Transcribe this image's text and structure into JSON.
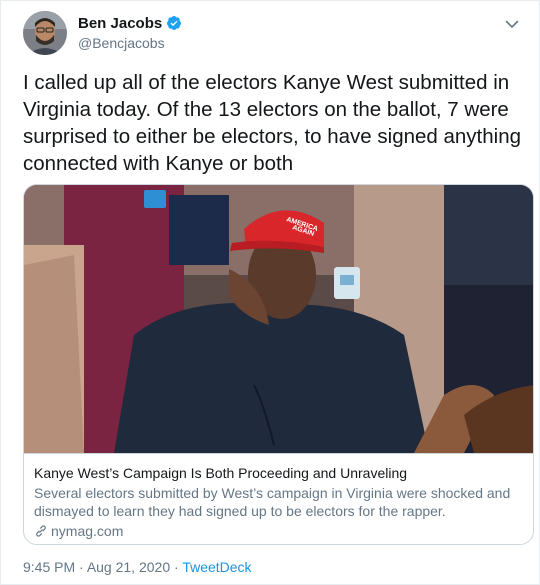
{
  "author": {
    "display_name": "Ben Jacobs",
    "handle": "@Bencjacobs",
    "verified": true,
    "avatar_icon": "avatar-photo",
    "menu_icon": "chevron-down-icon"
  },
  "tweet": {
    "text": "I called up all of the electors Kanye West submitted in Virginia today. Of the 13 electors on the ballot, 7 were surprised to either be electors, to have signed anything connected with Kanye or both"
  },
  "card": {
    "title": "Kanye West’s Campaign Is Both Proceeding and Unraveling",
    "description": "Several electors submitted by West’s campaign in Virginia were shocked and dismayed to learn they had signed up to be electors for the rapper.",
    "domain": "nymag.com",
    "domain_icon": "link-icon",
    "image_hat_text": [
      "AMERICA",
      "AGAIN"
    ]
  },
  "meta": {
    "time": "9:45 PM",
    "separator": " · ",
    "date": "Aug 21, 2020",
    "source": "TweetDeck"
  },
  "colors": {
    "text_primary": "#14171a",
    "text_secondary": "#657786",
    "link": "#1b95e0",
    "verified": "#1da1f2",
    "border": "#ccd6dd",
    "hat_red": "#d8262b"
  }
}
